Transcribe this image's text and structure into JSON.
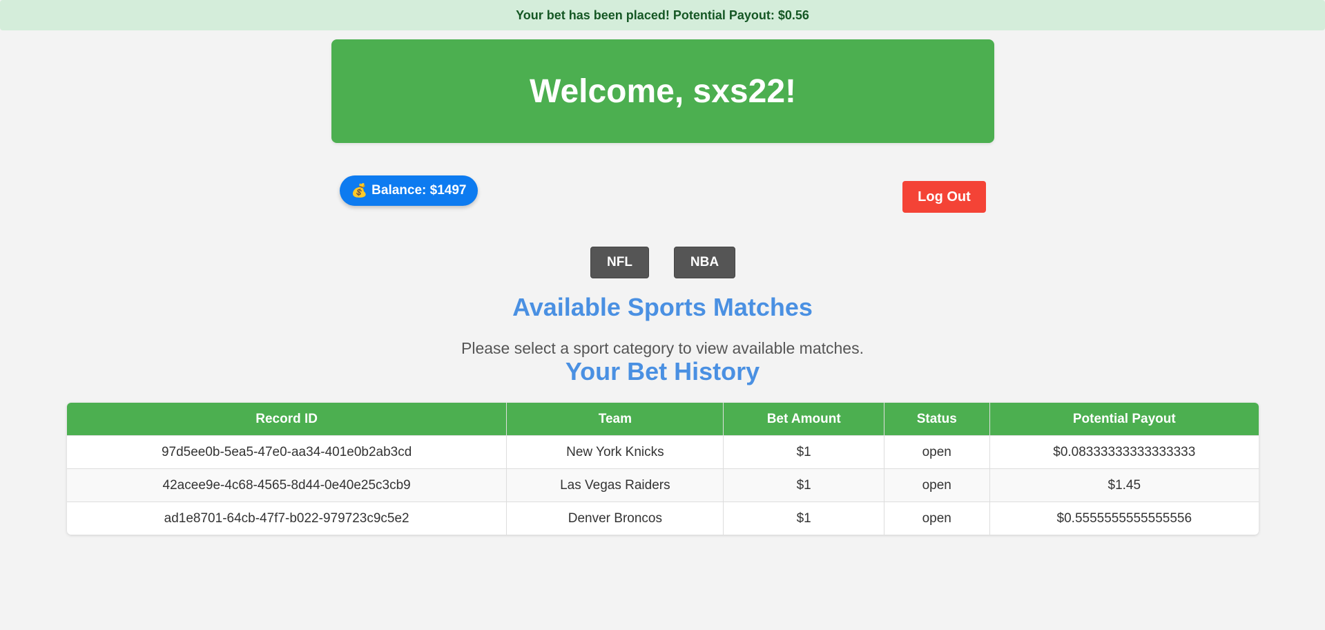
{
  "flash": {
    "message": "Your bet has been placed! Potential Payout: $0.56"
  },
  "header": {
    "welcome": "Welcome, sxs22!"
  },
  "balance": {
    "icon": "money-bag-icon",
    "glyph": "💰",
    "label": "Balance: $1497"
  },
  "actions": {
    "logout_label": "Log Out"
  },
  "sports": {
    "nfl_label": "NFL",
    "nba_label": "NBA"
  },
  "matches": {
    "title": "Available Sports Matches",
    "note": "Please select a sport category to view available matches."
  },
  "history": {
    "title": "Your Bet History",
    "columns": [
      "Record ID",
      "Team",
      "Bet Amount",
      "Status",
      "Potential Payout"
    ],
    "rows": [
      [
        "97d5ee0b-5ea5-47e0-aa34-401e0b2ab3cd",
        "New York Knicks",
        "$1",
        "open",
        "$0.08333333333333333"
      ],
      [
        "42acee9e-4c68-4565-8d44-0e40e25c3cb9",
        "Las Vegas Raiders",
        "$1",
        "open",
        "$1.45"
      ],
      [
        "ad1e8701-64cb-47f7-b022-979723c9c5e2",
        "Denver Broncos",
        "$1",
        "open",
        "$0.5555555555555556"
      ]
    ]
  },
  "colors": {
    "header_green": "#4caf50",
    "balance_blue": "#0d7bf0",
    "logout_red": "#f44336",
    "heading_blue": "#4a90e2",
    "sport_button_gray": "#555555"
  }
}
